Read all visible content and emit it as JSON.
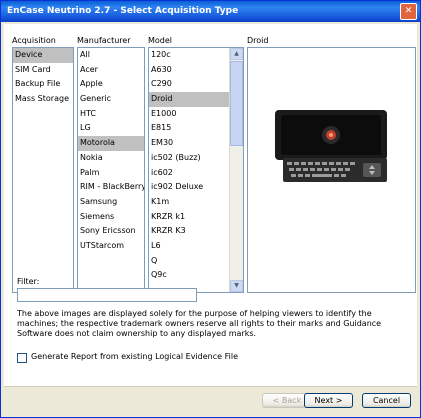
{
  "window": {
    "title": "EnCase Neutrino 2.7 - Select Acquisition Type",
    "close_glyph": "✕"
  },
  "acquisition": {
    "label": "Acquisition",
    "items": [
      "Device",
      "SIM Card",
      "Backup File",
      "Mass Storage"
    ],
    "selected": "Device"
  },
  "manufacturer": {
    "label": "Manufacturer",
    "items": [
      "All",
      "Acer",
      "Apple",
      "Generic",
      "HTC",
      "LG",
      "Motorola",
      "Nokia",
      "Palm",
      "RIM - BlackBerry",
      "Samsung",
      "Siemens",
      "Sony Ericsson",
      "UTStarcom"
    ],
    "selected": "Motorola"
  },
  "model": {
    "label": "Model",
    "items": [
      "120c",
      "A630",
      "C290",
      "Droid",
      "E1000",
      "E815",
      "EM30",
      "ic502 (Buzz)",
      "ic602",
      "ic902 Deluxe",
      "K1m",
      "KRZR k1",
      "KRZR K3",
      "L6",
      "Q",
      "Q9c"
    ],
    "selected": "Droid"
  },
  "preview": {
    "label": "Droid",
    "image": "droid-phone-image"
  },
  "filter": {
    "label": "Filter:",
    "value": ""
  },
  "disclaimer": "The above images are displayed solely for the purpose of helping viewers to identify the machines; the respective trademark owners reserve all rights to their marks and Guidance Software does not claim ownership to any displayed marks.",
  "report_checkbox": {
    "label": "Generate Report from existing Logical Evidence File",
    "checked": false
  },
  "buttons": {
    "back": "< Back",
    "next": "Next >",
    "cancel": "Cancel"
  },
  "colors": {
    "titlebar": "#0a5fd6",
    "selection": "#c0c0c0",
    "dialog_bg": "#ece9d8"
  }
}
